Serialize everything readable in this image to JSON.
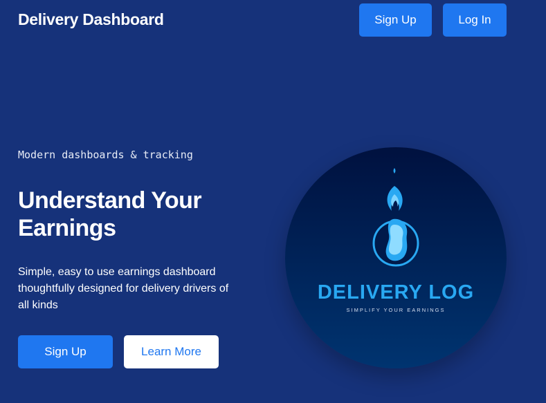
{
  "header": {
    "title": "Delivery Dashboard",
    "signup_label": "Sign Up",
    "login_label": "Log In"
  },
  "hero": {
    "tagline": "Modern dashboards & tracking",
    "headline": "Understand Your Earnings",
    "description": "Simple, easy to use earnings dashboard thoughtfully designed for delivery drivers of all kinds",
    "signup_label": "Sign Up",
    "learn_more_label": "Learn More"
  },
  "logo": {
    "title": "DELIVERY LOG",
    "subtitle": "SIMPLIFY YOUR EARNINGS",
    "icon": "flame-icon"
  },
  "colors": {
    "background": "#16327a",
    "accent": "#1f77f0",
    "logo_text": "#29a8f2"
  }
}
